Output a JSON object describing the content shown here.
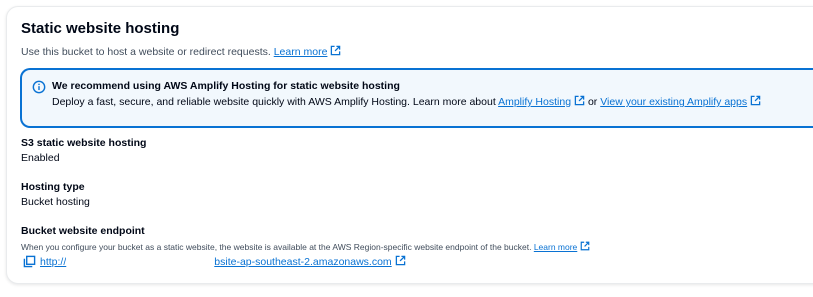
{
  "section": {
    "title": "Static website hosting",
    "description": "Use this bucket to host a website or redirect requests.",
    "learn_more": "Learn more"
  },
  "alert": {
    "title": "We recommend using AWS Amplify Hosting for static website hosting",
    "body_prefix": "Deploy a fast, secure, and reliable website quickly with AWS Amplify Hosting. Learn more about",
    "amplify_link": "Amplify Hosting",
    "or_text": "or",
    "existing_link": "View your existing Amplify apps",
    "icon": "info-icon"
  },
  "fields": {
    "s3_hosting": {
      "label": "S3 static website hosting",
      "value": "Enabled"
    },
    "hosting_type": {
      "label": "Hosting type",
      "value": "Bucket hosting"
    },
    "endpoint": {
      "label": "Bucket website endpoint",
      "hint": "When you configure your bucket as a static website, the website is available at the AWS Region-specific website endpoint of the bucket.",
      "hint_link": "Learn more",
      "url_prefix": "http://",
      "url_suffix": "bsite-ap-southeast-2.amazonaws.com",
      "copy_icon": "copy-icon"
    }
  },
  "colors": {
    "link": "#0972d3",
    "alert_border": "#0972d3",
    "alert_bg": "#f2f8fd",
    "text": "#000716",
    "muted": "#414d5c"
  }
}
